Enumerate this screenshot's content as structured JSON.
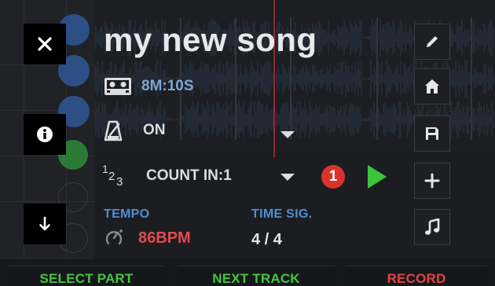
{
  "song": {
    "title": "my new song",
    "duration": "8M:10S"
  },
  "metronome": {
    "label": "ON"
  },
  "count_in": {
    "label": "COUNT IN:1",
    "badge": "1",
    "signature_glyph_top": "1",
    "signature_glyph_mid": "2",
    "signature_glyph_bot": "3"
  },
  "tempo": {
    "caption": "TEMPO",
    "value": "86BPM"
  },
  "time_signature": {
    "caption": "TIME SIG.",
    "value": "4 / 4"
  },
  "left_buttons": [
    {
      "icon": "close-icon"
    },
    {
      "icon": "info-icon"
    },
    {
      "icon": "arrow-down-icon"
    }
  ],
  "right_buttons": [
    {
      "icon": "pencil-icon"
    },
    {
      "icon": "home-icon"
    },
    {
      "icon": "save-icon"
    },
    {
      "icon": "plus-icon"
    },
    {
      "icon": "music-note-icon"
    }
  ],
  "bottom": {
    "select_part": "SELECT PART",
    "next_track": "NEXT TRACK",
    "record": "RECORD"
  },
  "colors": {
    "accent_blue": "#4e8fd6",
    "green": "#3cc43c",
    "red": "#e24c4c",
    "badge_red": "#d9342b"
  }
}
